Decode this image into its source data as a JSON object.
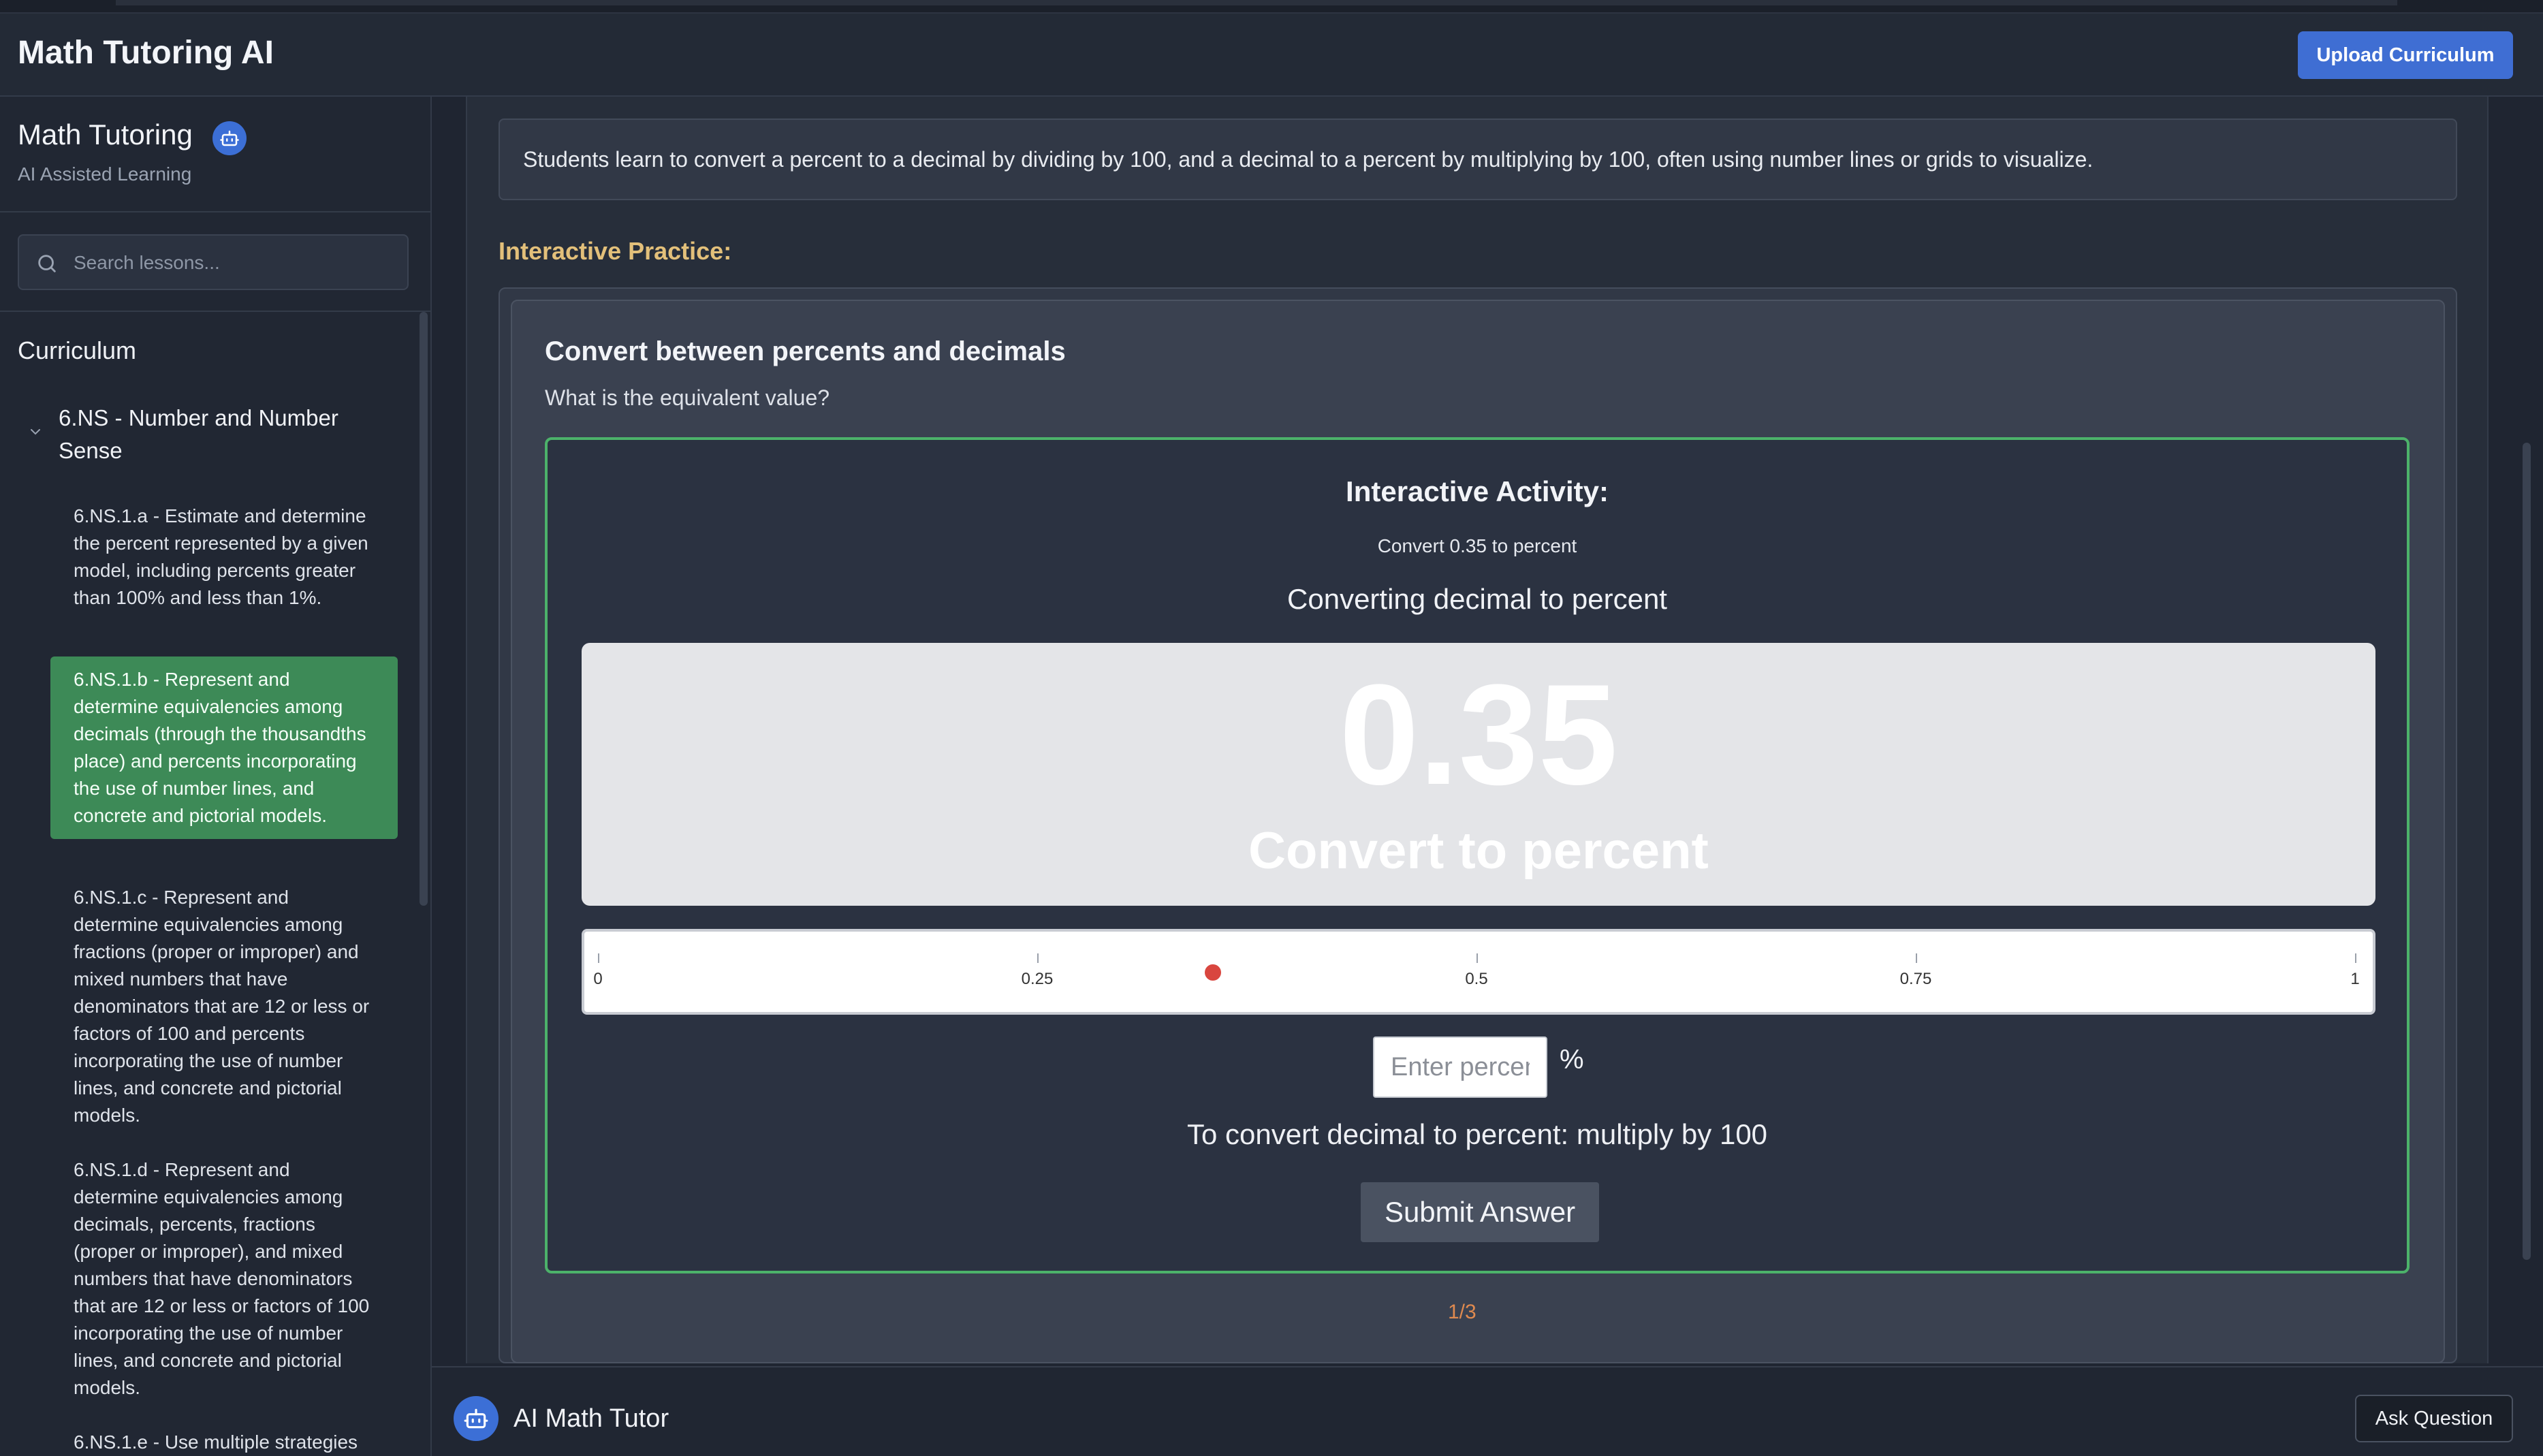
{
  "header": {
    "app_title": "Math Tutoring AI",
    "upload_label": "Upload Curriculum"
  },
  "sidebar": {
    "brand": "Math Tutoring",
    "subtitle": "AI Assisted Learning",
    "search_placeholder": "Search lessons...",
    "curriculum_title": "Curriculum",
    "group_title": "6.NS - Number and Number Sense",
    "lessons": [
      {
        "label": "6.NS.1.a - Estimate and determine the percent represented by a given model, including percents greater than 100% and less than 1%.",
        "active": false
      },
      {
        "label": "6.NS.1.b - Represent and determine equivalencies among decimals (through the thousandths place) and percents incorporating the use of number lines, and concrete and pictorial models.",
        "active": true
      },
      {
        "label": "6.NS.1.c - Represent and determine equivalencies among fractions (proper or improper) and mixed numbers that have denominators that are 12 or less or factors of 100 and percents incorporating the use of number lines, and concrete and pictorial models.",
        "active": false
      },
      {
        "label": "6.NS.1.d - Represent and determine equivalencies among decimals, percents, fractions (proper or improper), and mixed numbers that have denominators that are 12 or less or factors of 100 incorporating the use of number lines, and concrete and pictorial models.",
        "active": false
      },
      {
        "label": "6.NS.1.e - Use multiple strategies",
        "active": false
      }
    ]
  },
  "main": {
    "description": "Students learn to convert a percent to a decimal by dividing by 100, and a decimal to a percent by multiplying by 100, often using number lines or grids to visualize.",
    "practice_label": "Interactive Practice:",
    "question_title": "Convert between percents and decimals",
    "question_sub": "What is the equivalent value?",
    "activity": {
      "title": "Interactive Activity:",
      "prompt": "Convert 0.35 to percent",
      "mode": "Converting decimal to percent",
      "big_value": "0.35",
      "big_caption": "Convert to percent",
      "number_line": {
        "ticks": [
          "0",
          "0.25",
          "0.5",
          "0.75",
          "1"
        ],
        "marker_value": 0.35
      },
      "input_placeholder": "Enter percent",
      "percent_sign": "%",
      "hint": "To convert decimal to percent: multiply by 100",
      "submit_label": "Submit Answer"
    },
    "pager": "1/3"
  },
  "tutor": {
    "label": "AI Math Tutor",
    "ask_label": "Ask Question"
  },
  "colors": {
    "accent": "#3f6ed3",
    "active_lesson": "#3d8a57",
    "activity_border": "#4cb26a",
    "practice_label": "#e3c07a",
    "marker": "#d9463f"
  },
  "icons": {
    "brand": "robot-icon",
    "search": "search-icon",
    "group": "chevron-down-icon",
    "tutor": "robot-icon"
  }
}
